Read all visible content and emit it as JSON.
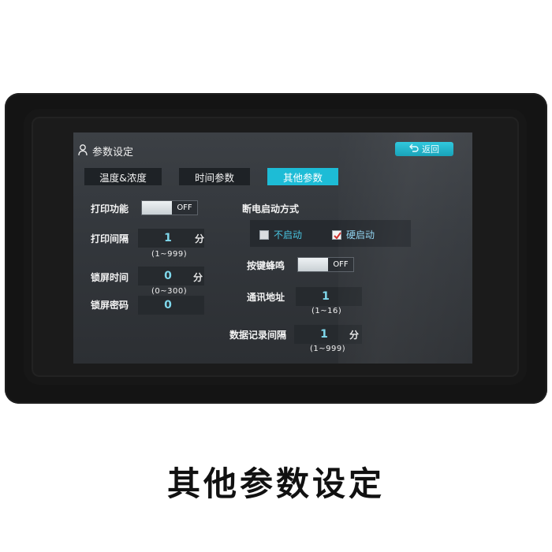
{
  "header": {
    "title": "参数设定",
    "back_label": "返回"
  },
  "tabs": [
    {
      "label": "温度&浓度",
      "active": false
    },
    {
      "label": "时间参数",
      "active": false
    },
    {
      "label": "其他参数",
      "active": true
    }
  ],
  "left": {
    "print_function": {
      "label": "打印功能",
      "state": "OFF"
    },
    "print_interval": {
      "label": "打印间隔",
      "value": "1",
      "unit": "分",
      "range": "(1~999)"
    },
    "lock_time": {
      "label": "锁屏时间",
      "value": "0",
      "unit": "分",
      "range": "(0~300)"
    },
    "lock_password": {
      "label": "锁屏密码",
      "value": "0"
    }
  },
  "right": {
    "power_on_mode": {
      "label": "断电启动方式",
      "options": [
        {
          "label": "不启动",
          "checked": false
        },
        {
          "label": "硬启动",
          "checked": true
        }
      ]
    },
    "key_beep": {
      "label": "按键蜂鸣",
      "state": "OFF"
    },
    "comm_address": {
      "label": "通讯地址",
      "value": "1",
      "range": "(1~16)"
    },
    "data_record_interval": {
      "label": "数据记录间隔",
      "value": "1",
      "unit": "分",
      "range": "(1~999)"
    }
  },
  "caption": "其他参数设定",
  "colors": {
    "accent": "#1dbcd6",
    "value_text": "#7fd8ec",
    "check_red": "#d0312d"
  }
}
